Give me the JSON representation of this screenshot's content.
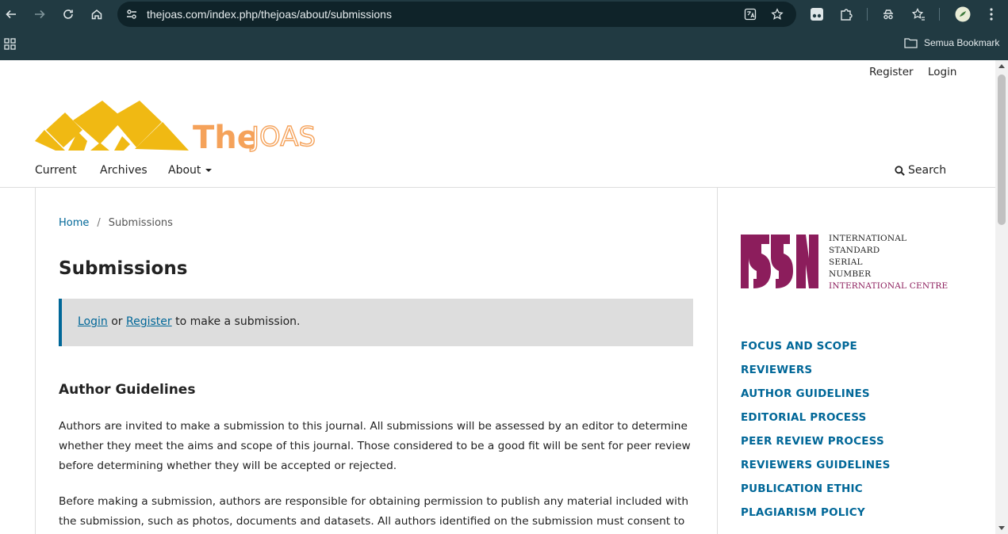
{
  "browser": {
    "url": "thejoas.com/index.php/thejoas/about/submissions",
    "bookmarks_label": "Semua Bookmark"
  },
  "user_nav": {
    "register": "Register",
    "login": "Login"
  },
  "logo": {
    "text_a": "The",
    "text_b": "JOAS"
  },
  "main_nav": {
    "current": "Current",
    "archives": "Archives",
    "about": "About",
    "search": "Search"
  },
  "breadcrumb": {
    "home": "Home",
    "separator": "/",
    "current": "Submissions"
  },
  "page": {
    "title": "Submissions",
    "notice": {
      "login": "Login",
      "or": "or",
      "register": "Register",
      "suffix": "to make a submission."
    },
    "author_guidelines_title": "Author Guidelines",
    "paragraph1": "Authors are invited to make a submission to this journal. All submissions will be assessed by an editor to determine whether they meet the aims and scope of this journal. Those considered to be a good fit will be sent for peer review before determining whether they will be accepted or rejected.",
    "paragraph2": "Before making a submission, authors are responsible for obtaining permission to publish any material included with the submission, such as photos, documents and datasets. All authors identified on the submission must consent to be"
  },
  "sidebar": {
    "issn": {
      "mark": "ISSN",
      "line1": "INTERNATIONAL",
      "line2": "STANDARD",
      "line3": "SERIAL",
      "line4": "NUMBER",
      "line5": "INTERNATIONAL CENTRE"
    },
    "links": [
      "FOCUS AND SCOPE",
      "REVIEWERS",
      "AUTHOR GUIDELINES",
      "EDITORIAL PROCESS",
      "PEER REVIEW PROCESS",
      "REVIEWERS GUIDELINES",
      "PUBLICATION ETHIC",
      "PLAGIARISM POLICY"
    ]
  },
  "colors": {
    "chrome": "#213a42",
    "link": "#006798",
    "logo_yellow": "#f0b913",
    "logo_orange": "#f5a25a",
    "issn_maroon": "#8c1d5c"
  }
}
